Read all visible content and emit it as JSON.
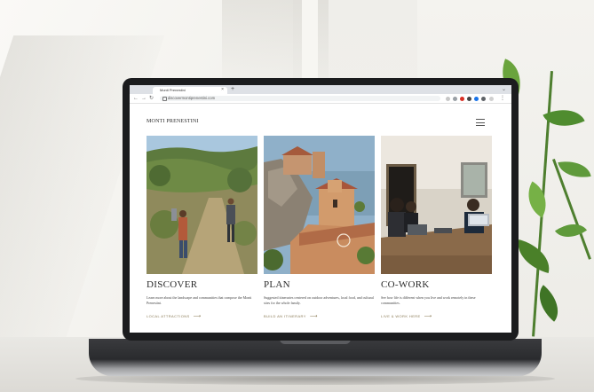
{
  "browser": {
    "tab_title": "Monti Prenestini",
    "tab_close": "×",
    "new_tab": "+",
    "url": "discovermontiprenestini.com"
  },
  "site": {
    "title": "MONTI PRENESTINI"
  },
  "columns": [
    {
      "title": "DISCOVER",
      "description": "Learn more about the landscape and communities that compose the Monti Prenestini.",
      "link": "LOCAL ATTRACTIONS",
      "arrow": "⟶"
    },
    {
      "title": "PLAN",
      "description": "Suggested itineraries centered on outdoor adventures, local food, and cultural sites for the whole family.",
      "link": "BUILD AN ITINERARY",
      "arrow": "⟶"
    },
    {
      "title": "CO-WORK",
      "description": "See how life is different when you live and work remotely in these communities.",
      "link": "LIVE & WORK HERE",
      "arrow": "⟶"
    }
  ],
  "colors": {
    "link": "#8a7a55",
    "bezel": "#1b1c1e",
    "leaf": "#5f9a3b"
  }
}
